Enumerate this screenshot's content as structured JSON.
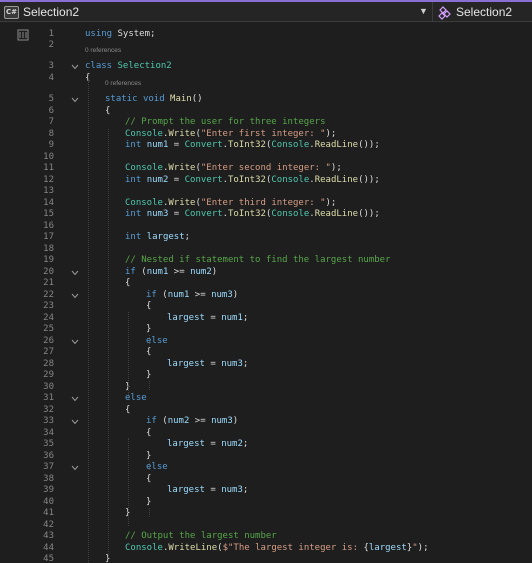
{
  "navbar": {
    "file_icon_text": "C#",
    "left_title": "Selection2",
    "right_title": "Selection2"
  },
  "codelens": {
    "class_refs": "0 references",
    "main_refs": "0 references"
  },
  "lines": [
    {
      "n": "1",
      "indent": 0,
      "tokens": [
        [
          "kw",
          "using"
        ],
        [
          "plain",
          " System;"
        ]
      ]
    },
    {
      "n": "2",
      "indent": 0,
      "tokens": []
    },
    {
      "n": "3",
      "indent": 0,
      "tokens": [
        [
          "kw",
          "class"
        ],
        [
          "plain",
          " "
        ],
        [
          "cls",
          "Selection2"
        ]
      ]
    },
    {
      "n": "4",
      "indent": 0,
      "tokens": [
        [
          "plain",
          "{"
        ]
      ]
    },
    {
      "n": "5",
      "indent": 1,
      "tokens": [
        [
          "kw",
          "static"
        ],
        [
          "plain",
          " "
        ],
        [
          "kw",
          "void"
        ],
        [
          "plain",
          " "
        ],
        [
          "mth",
          "Main"
        ],
        [
          "plain",
          "()"
        ]
      ]
    },
    {
      "n": "6",
      "indent": 1,
      "tokens": [
        [
          "plain",
          "{"
        ]
      ]
    },
    {
      "n": "7",
      "indent": 2,
      "tokens": [
        [
          "cmt",
          "// Prompt the user for three integers"
        ]
      ]
    },
    {
      "n": "8",
      "indent": 2,
      "tokens": [
        [
          "cls",
          "Console"
        ],
        [
          "plain",
          "."
        ],
        [
          "mth",
          "Write"
        ],
        [
          "plain",
          "("
        ],
        [
          "str",
          "\"Enter first integer: \""
        ],
        [
          "plain",
          ");"
        ]
      ]
    },
    {
      "n": "9",
      "indent": 2,
      "tokens": [
        [
          "kw",
          "int"
        ],
        [
          "plain",
          " "
        ],
        [
          "var",
          "num1"
        ],
        [
          "plain",
          " = "
        ],
        [
          "cls",
          "Convert"
        ],
        [
          "plain",
          "."
        ],
        [
          "mth",
          "ToInt32"
        ],
        [
          "plain",
          "("
        ],
        [
          "cls",
          "Console"
        ],
        [
          "plain",
          "."
        ],
        [
          "mth",
          "ReadLine"
        ],
        [
          "plain",
          "());"
        ]
      ]
    },
    {
      "n": "10",
      "indent": 2,
      "tokens": []
    },
    {
      "n": "11",
      "indent": 2,
      "tokens": [
        [
          "cls",
          "Console"
        ],
        [
          "plain",
          "."
        ],
        [
          "mth",
          "Write"
        ],
        [
          "plain",
          "("
        ],
        [
          "str",
          "\"Enter second integer: \""
        ],
        [
          "plain",
          ");"
        ]
      ]
    },
    {
      "n": "12",
      "indent": 2,
      "tokens": [
        [
          "kw",
          "int"
        ],
        [
          "plain",
          " "
        ],
        [
          "var",
          "num2"
        ],
        [
          "plain",
          " = "
        ],
        [
          "cls",
          "Convert"
        ],
        [
          "plain",
          "."
        ],
        [
          "mth",
          "ToInt32"
        ],
        [
          "plain",
          "("
        ],
        [
          "cls",
          "Console"
        ],
        [
          "plain",
          "."
        ],
        [
          "mth",
          "ReadLine"
        ],
        [
          "plain",
          "());"
        ]
      ]
    },
    {
      "n": "13",
      "indent": 2,
      "tokens": []
    },
    {
      "n": "14",
      "indent": 2,
      "tokens": [
        [
          "cls",
          "Console"
        ],
        [
          "plain",
          "."
        ],
        [
          "mth",
          "Write"
        ],
        [
          "plain",
          "("
        ],
        [
          "str",
          "\"Enter third integer: \""
        ],
        [
          "plain",
          ");"
        ]
      ]
    },
    {
      "n": "15",
      "indent": 2,
      "tokens": [
        [
          "kw",
          "int"
        ],
        [
          "plain",
          " "
        ],
        [
          "var",
          "num3"
        ],
        [
          "plain",
          " = "
        ],
        [
          "cls",
          "Convert"
        ],
        [
          "plain",
          "."
        ],
        [
          "mth",
          "ToInt32"
        ],
        [
          "plain",
          "("
        ],
        [
          "cls",
          "Console"
        ],
        [
          "plain",
          "."
        ],
        [
          "mth",
          "ReadLine"
        ],
        [
          "plain",
          "());"
        ]
      ]
    },
    {
      "n": "16",
      "indent": 2,
      "tokens": []
    },
    {
      "n": "17",
      "indent": 2,
      "tokens": [
        [
          "kw",
          "int"
        ],
        [
          "plain",
          " "
        ],
        [
          "var",
          "largest"
        ],
        [
          "plain",
          ";"
        ]
      ]
    },
    {
      "n": "18",
      "indent": 2,
      "tokens": []
    },
    {
      "n": "19",
      "indent": 2,
      "tokens": [
        [
          "cmt",
          "// Nested if statement to find the largest number"
        ]
      ]
    },
    {
      "n": "20",
      "indent": 2,
      "tokens": [
        [
          "kw",
          "if"
        ],
        [
          "plain",
          " ("
        ],
        [
          "var",
          "num1"
        ],
        [
          "plain",
          " >= "
        ],
        [
          "var",
          "num2"
        ],
        [
          "plain",
          ")"
        ]
      ]
    },
    {
      "n": "21",
      "indent": 2,
      "tokens": [
        [
          "plain",
          "{"
        ]
      ]
    },
    {
      "n": "22",
      "indent": 3,
      "tokens": [
        [
          "kw",
          "if"
        ],
        [
          "plain",
          " ("
        ],
        [
          "var",
          "num1"
        ],
        [
          "plain",
          " >= "
        ],
        [
          "var",
          "num3"
        ],
        [
          "plain",
          ")"
        ]
      ]
    },
    {
      "n": "23",
      "indent": 3,
      "tokens": [
        [
          "plain",
          "{"
        ]
      ]
    },
    {
      "n": "24",
      "indent": 4,
      "tokens": [
        [
          "var",
          "largest"
        ],
        [
          "plain",
          " = "
        ],
        [
          "var",
          "num1"
        ],
        [
          "plain",
          ";"
        ]
      ]
    },
    {
      "n": "25",
      "indent": 3,
      "tokens": [
        [
          "plain",
          "}"
        ]
      ]
    },
    {
      "n": "26",
      "indent": 3,
      "tokens": [
        [
          "kw",
          "else"
        ]
      ]
    },
    {
      "n": "27",
      "indent": 3,
      "tokens": [
        [
          "plain",
          "{"
        ]
      ]
    },
    {
      "n": "28",
      "indent": 4,
      "tokens": [
        [
          "var",
          "largest"
        ],
        [
          "plain",
          " = "
        ],
        [
          "var",
          "num3"
        ],
        [
          "plain",
          ";"
        ]
      ]
    },
    {
      "n": "29",
      "indent": 3,
      "tokens": [
        [
          "plain",
          "}"
        ]
      ]
    },
    {
      "n": "30",
      "indent": 2,
      "tokens": [
        [
          "plain",
          "}"
        ]
      ]
    },
    {
      "n": "31",
      "indent": 2,
      "tokens": [
        [
          "kw",
          "else"
        ]
      ]
    },
    {
      "n": "32",
      "indent": 2,
      "tokens": [
        [
          "plain",
          "{"
        ]
      ]
    },
    {
      "n": "33",
      "indent": 3,
      "tokens": [
        [
          "kw",
          "if"
        ],
        [
          "plain",
          " ("
        ],
        [
          "var",
          "num2"
        ],
        [
          "plain",
          " >= "
        ],
        [
          "var",
          "num3"
        ],
        [
          "plain",
          ")"
        ]
      ]
    },
    {
      "n": "34",
      "indent": 3,
      "tokens": [
        [
          "plain",
          "{"
        ]
      ]
    },
    {
      "n": "35",
      "indent": 4,
      "tokens": [
        [
          "var",
          "largest"
        ],
        [
          "plain",
          " = "
        ],
        [
          "var",
          "num2"
        ],
        [
          "plain",
          ";"
        ]
      ]
    },
    {
      "n": "36",
      "indent": 3,
      "tokens": [
        [
          "plain",
          "}"
        ]
      ]
    },
    {
      "n": "37",
      "indent": 3,
      "tokens": [
        [
          "kw",
          "else"
        ]
      ]
    },
    {
      "n": "38",
      "indent": 3,
      "tokens": [
        [
          "plain",
          "{"
        ]
      ]
    },
    {
      "n": "39",
      "indent": 4,
      "tokens": [
        [
          "var",
          "largest"
        ],
        [
          "plain",
          " = "
        ],
        [
          "var",
          "num3"
        ],
        [
          "plain",
          ";"
        ]
      ]
    },
    {
      "n": "40",
      "indent": 3,
      "tokens": [
        [
          "plain",
          "}"
        ]
      ]
    },
    {
      "n": "41",
      "indent": 2,
      "tokens": [
        [
          "plain",
          "}"
        ]
      ]
    },
    {
      "n": "42",
      "indent": 2,
      "tokens": []
    },
    {
      "n": "43",
      "indent": 2,
      "tokens": [
        [
          "cmt",
          "// Output the largest number"
        ]
      ]
    },
    {
      "n": "44",
      "indent": 2,
      "tokens": [
        [
          "cls",
          "Console"
        ],
        [
          "plain",
          "."
        ],
        [
          "mth",
          "WriteLine"
        ],
        [
          "plain",
          "("
        ],
        [
          "str",
          "$\"The largest integer is: "
        ],
        [
          "interp",
          "{"
        ],
        [
          "var",
          "largest"
        ],
        [
          "interp",
          "}"
        ],
        [
          "str",
          "\""
        ],
        [
          "plain",
          ");"
        ]
      ]
    },
    {
      "n": "45",
      "indent": 1,
      "tokens": [
        [
          "plain",
          "}"
        ]
      ]
    }
  ]
}
